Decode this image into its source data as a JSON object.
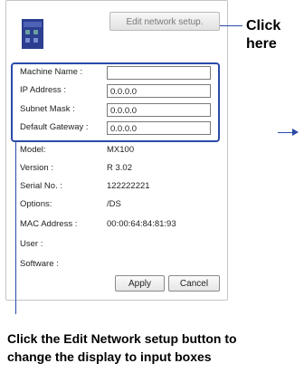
{
  "edit_button_label": "Edit network setup.",
  "callout": [
    "Click",
    "here"
  ],
  "form_fields": [
    {
      "label": "Machine Name :",
      "value": ""
    },
    {
      "label": "IP Address :",
      "value": "0.0.0.0"
    },
    {
      "label": "Subnet Mask :",
      "value": "0.0.0.0"
    },
    {
      "label": "Default Gateway :",
      "value": "0.0.0.0"
    }
  ],
  "info_rows": [
    {
      "label": "Model:",
      "value": "MX100"
    },
    {
      "label": "Version :",
      "value": "R 3.02"
    },
    {
      "label": "Serial No. :",
      "value": "122222221"
    },
    {
      "label": "Options:",
      "value": "/DS"
    },
    {
      "label": "MAC Address :",
      "value": "00:00:64:84:81:93"
    },
    {
      "label": "User :",
      "value": ""
    },
    {
      "label": "Software :",
      "value": ""
    }
  ],
  "apply_label": "Apply",
  "cancel_label": "Cancel",
  "caption": [
    "Click the Edit Network setup button to",
    "change the display to input boxes"
  ],
  "colors": {
    "accent": "#2a4aa8",
    "panel_border": "#c4c4c4"
  }
}
